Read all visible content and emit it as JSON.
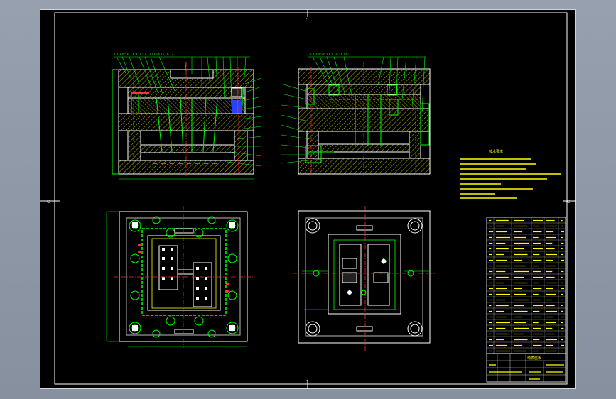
{
  "drawing": {
    "notes_heading": "技术要求",
    "title_block_name": "动模座板",
    "label_left_c": "C",
    "label_right_c": "C",
    "label_top_c": "C",
    "label_bottom_c": "C"
  },
  "colors": {
    "background": "#000000",
    "border": "#ffffff",
    "outline": "#ffffff",
    "geometry": "#00ff00",
    "centerline": "#ff2a2a",
    "hatch": "#c8c800",
    "text": "#ffff00",
    "dimension": "#00ffff",
    "viewport": "#919ba9"
  }
}
